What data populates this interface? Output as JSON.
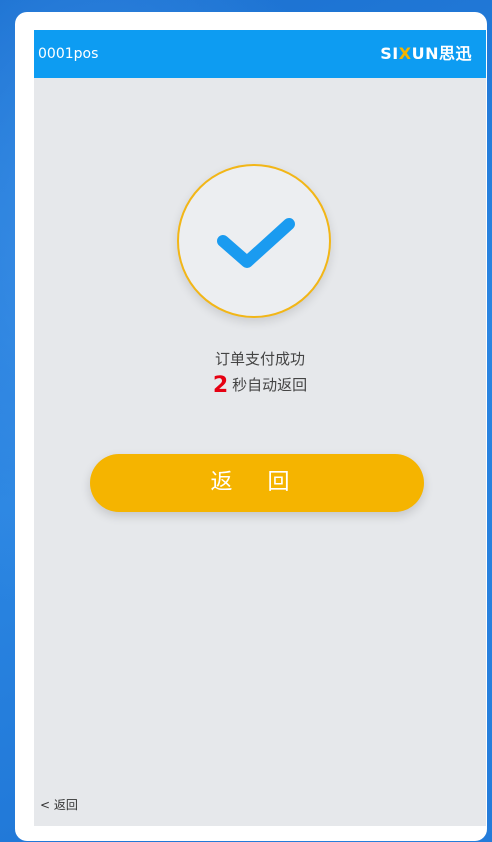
{
  "header": {
    "terminal_id": "0001pos",
    "brand_prefix": "SI",
    "brand_x": "X",
    "brand_suffix": "UN思迅"
  },
  "status": {
    "message": "订单支付成功",
    "countdown_value": "2",
    "countdown_text": "秒自动返回"
  },
  "actions": {
    "return_button": "返 回",
    "back_link": "< 返回"
  },
  "colors": {
    "header_bg": "#0d9cf2",
    "accent_button": "#f5b400",
    "check_ring": "#f2b617",
    "check_mark": "#1a9bf0",
    "countdown_number": "#e60012"
  }
}
